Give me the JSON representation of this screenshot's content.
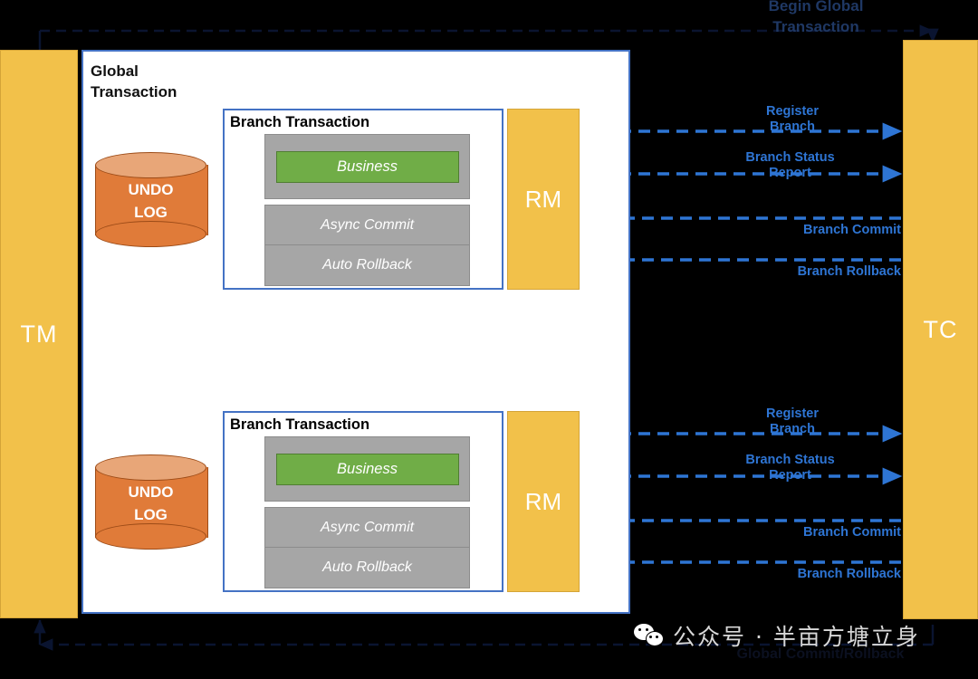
{
  "diagram": {
    "top_title": "Begin Global\nTransaction",
    "bottom_title": "Global Commit/Rollback",
    "tm_label": "TM",
    "tc_label": "TC",
    "global_transaction_label": "Global\nTransaction",
    "branch": {
      "title": "Branch Transaction",
      "business_label": "Business",
      "async_commit_label": "Async Commit",
      "auto_rollback_label": "Auto Rollback",
      "rm_label": "RM",
      "undo_log_label": "UNDO\nLOG"
    },
    "flows": [
      {
        "label": "Register\nBranch",
        "direction": "right"
      },
      {
        "label": "Branch Status\nReport",
        "direction": "right"
      },
      {
        "label": "Branch Commit",
        "direction": "left"
      },
      {
        "label": "Branch Rollback",
        "direction": "left"
      }
    ],
    "blocks": [
      {
        "register_branch": "Register\nBranch",
        "branch_status_report": "Branch Status\nReport",
        "branch_commit": "Branch Commit",
        "branch_rollback": "Branch Rollback"
      },
      {
        "register_branch": "Register\nBranch",
        "branch_status_report": "Branch Status\nReport",
        "branch_commit": "Branch Commit",
        "branch_rollback": "Branch Rollback"
      }
    ],
    "colors": {
      "pillar": "#F2C14A",
      "panel_border": "#4472C4",
      "grey_block": "#A6A6A6",
      "business_green": "#70AD47",
      "undo_log_orange": "#E07B39",
      "flow_blue": "#2E75D4",
      "background": "#000000"
    }
  },
  "watermark": {
    "icon": "wechat-icon",
    "text": "公众号 · 半亩方塘立身"
  }
}
